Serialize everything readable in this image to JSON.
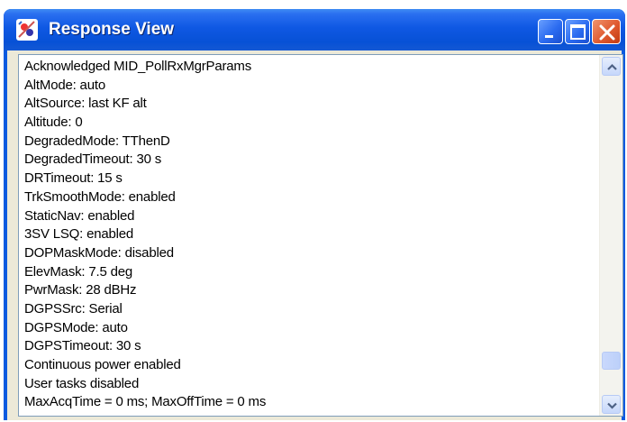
{
  "window": {
    "title": "Response View",
    "icons": {
      "app": "satellite-app-icon",
      "minimize": "minimize-icon",
      "maximize": "maximize-icon",
      "close": "close-icon"
    }
  },
  "response": {
    "lines": [
      "Acknowledged MID_PollRxMgrParams",
      "AltMode: auto",
      "AltSource: last KF alt",
      "Altitude: 0",
      "DegradedMode: TThenD",
      "DegradedTimeout: 30 s",
      "DRTimeout: 15 s",
      "TrkSmoothMode: enabled",
      "StaticNav: enabled",
      "3SV LSQ: enabled",
      "DOPMaskMode: disabled",
      "ElevMask: 7.5 deg",
      "PwrMask: 28 dBHz",
      "DGPSSrc: Serial",
      "DGPSMode: auto",
      "DGPSTimeout: 30 s",
      "Continuous power enabled",
      "User tasks disabled",
      "MaxAcqTime = 0 ms; MaxOffTime = 0 ms"
    ]
  },
  "scrollbar": {
    "position": 0.92
  }
}
